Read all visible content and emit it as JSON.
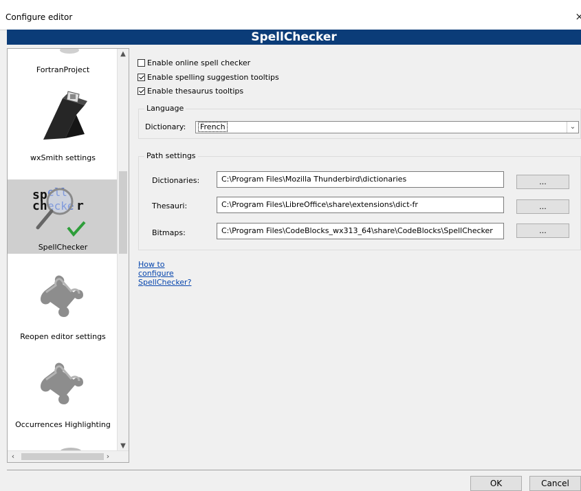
{
  "window": {
    "title": "Configure editor",
    "close_glyph": "×"
  },
  "panel": {
    "title": "SpellChecker"
  },
  "sidebar": {
    "items": [
      {
        "label": "FortranProject",
        "icon": "fortran-project-icon"
      },
      {
        "label": "wxSmith settings",
        "icon": "wxsmith-icon"
      },
      {
        "label": "SpellChecker",
        "icon": "spellchecker-icon",
        "selected": true,
        "icon_text": [
          "sp",
          "ell",
          "ch",
          "ecke",
          "r"
        ]
      },
      {
        "label": "Reopen editor settings",
        "icon": "puzzle-piece-icon"
      },
      {
        "label": "Occurrences Highlighting",
        "icon": "puzzle-piece-icon"
      }
    ]
  },
  "options": {
    "online_spell": {
      "label": "Enable online spell checker",
      "checked": false
    },
    "suggestion_tooltips": {
      "label": "Enable spelling suggestion tooltips",
      "checked": true
    },
    "thesaurus_tooltips": {
      "label": "Enable thesaurus tooltips",
      "checked": true
    }
  },
  "language": {
    "group_label": "Language",
    "dictionary_label": "Dictionary:",
    "dictionary_value": "French"
  },
  "paths": {
    "group_label": "Path settings",
    "dictionaries_label": "Dictionaries:",
    "dictionaries_value": "C:\\Program Files\\Mozilla Thunderbird\\dictionaries",
    "thesauri_label": "Thesauri:",
    "thesauri_value": "C:\\Program Files\\LibreOffice\\share\\extensions\\dict-fr",
    "bitmaps_label": "Bitmaps:",
    "bitmaps_value": "C:\\Program Files\\CodeBlocks_wx313_64\\share\\CodeBlocks\\SpellChecker",
    "browse_label": "..."
  },
  "help_link": "How to configure SpellChecker?",
  "buttons": {
    "ok": "OK",
    "cancel": "Cancel"
  },
  "colors": {
    "header": "#0b3c78",
    "link": "#0645ad",
    "check_green": "#2e9e3a"
  }
}
